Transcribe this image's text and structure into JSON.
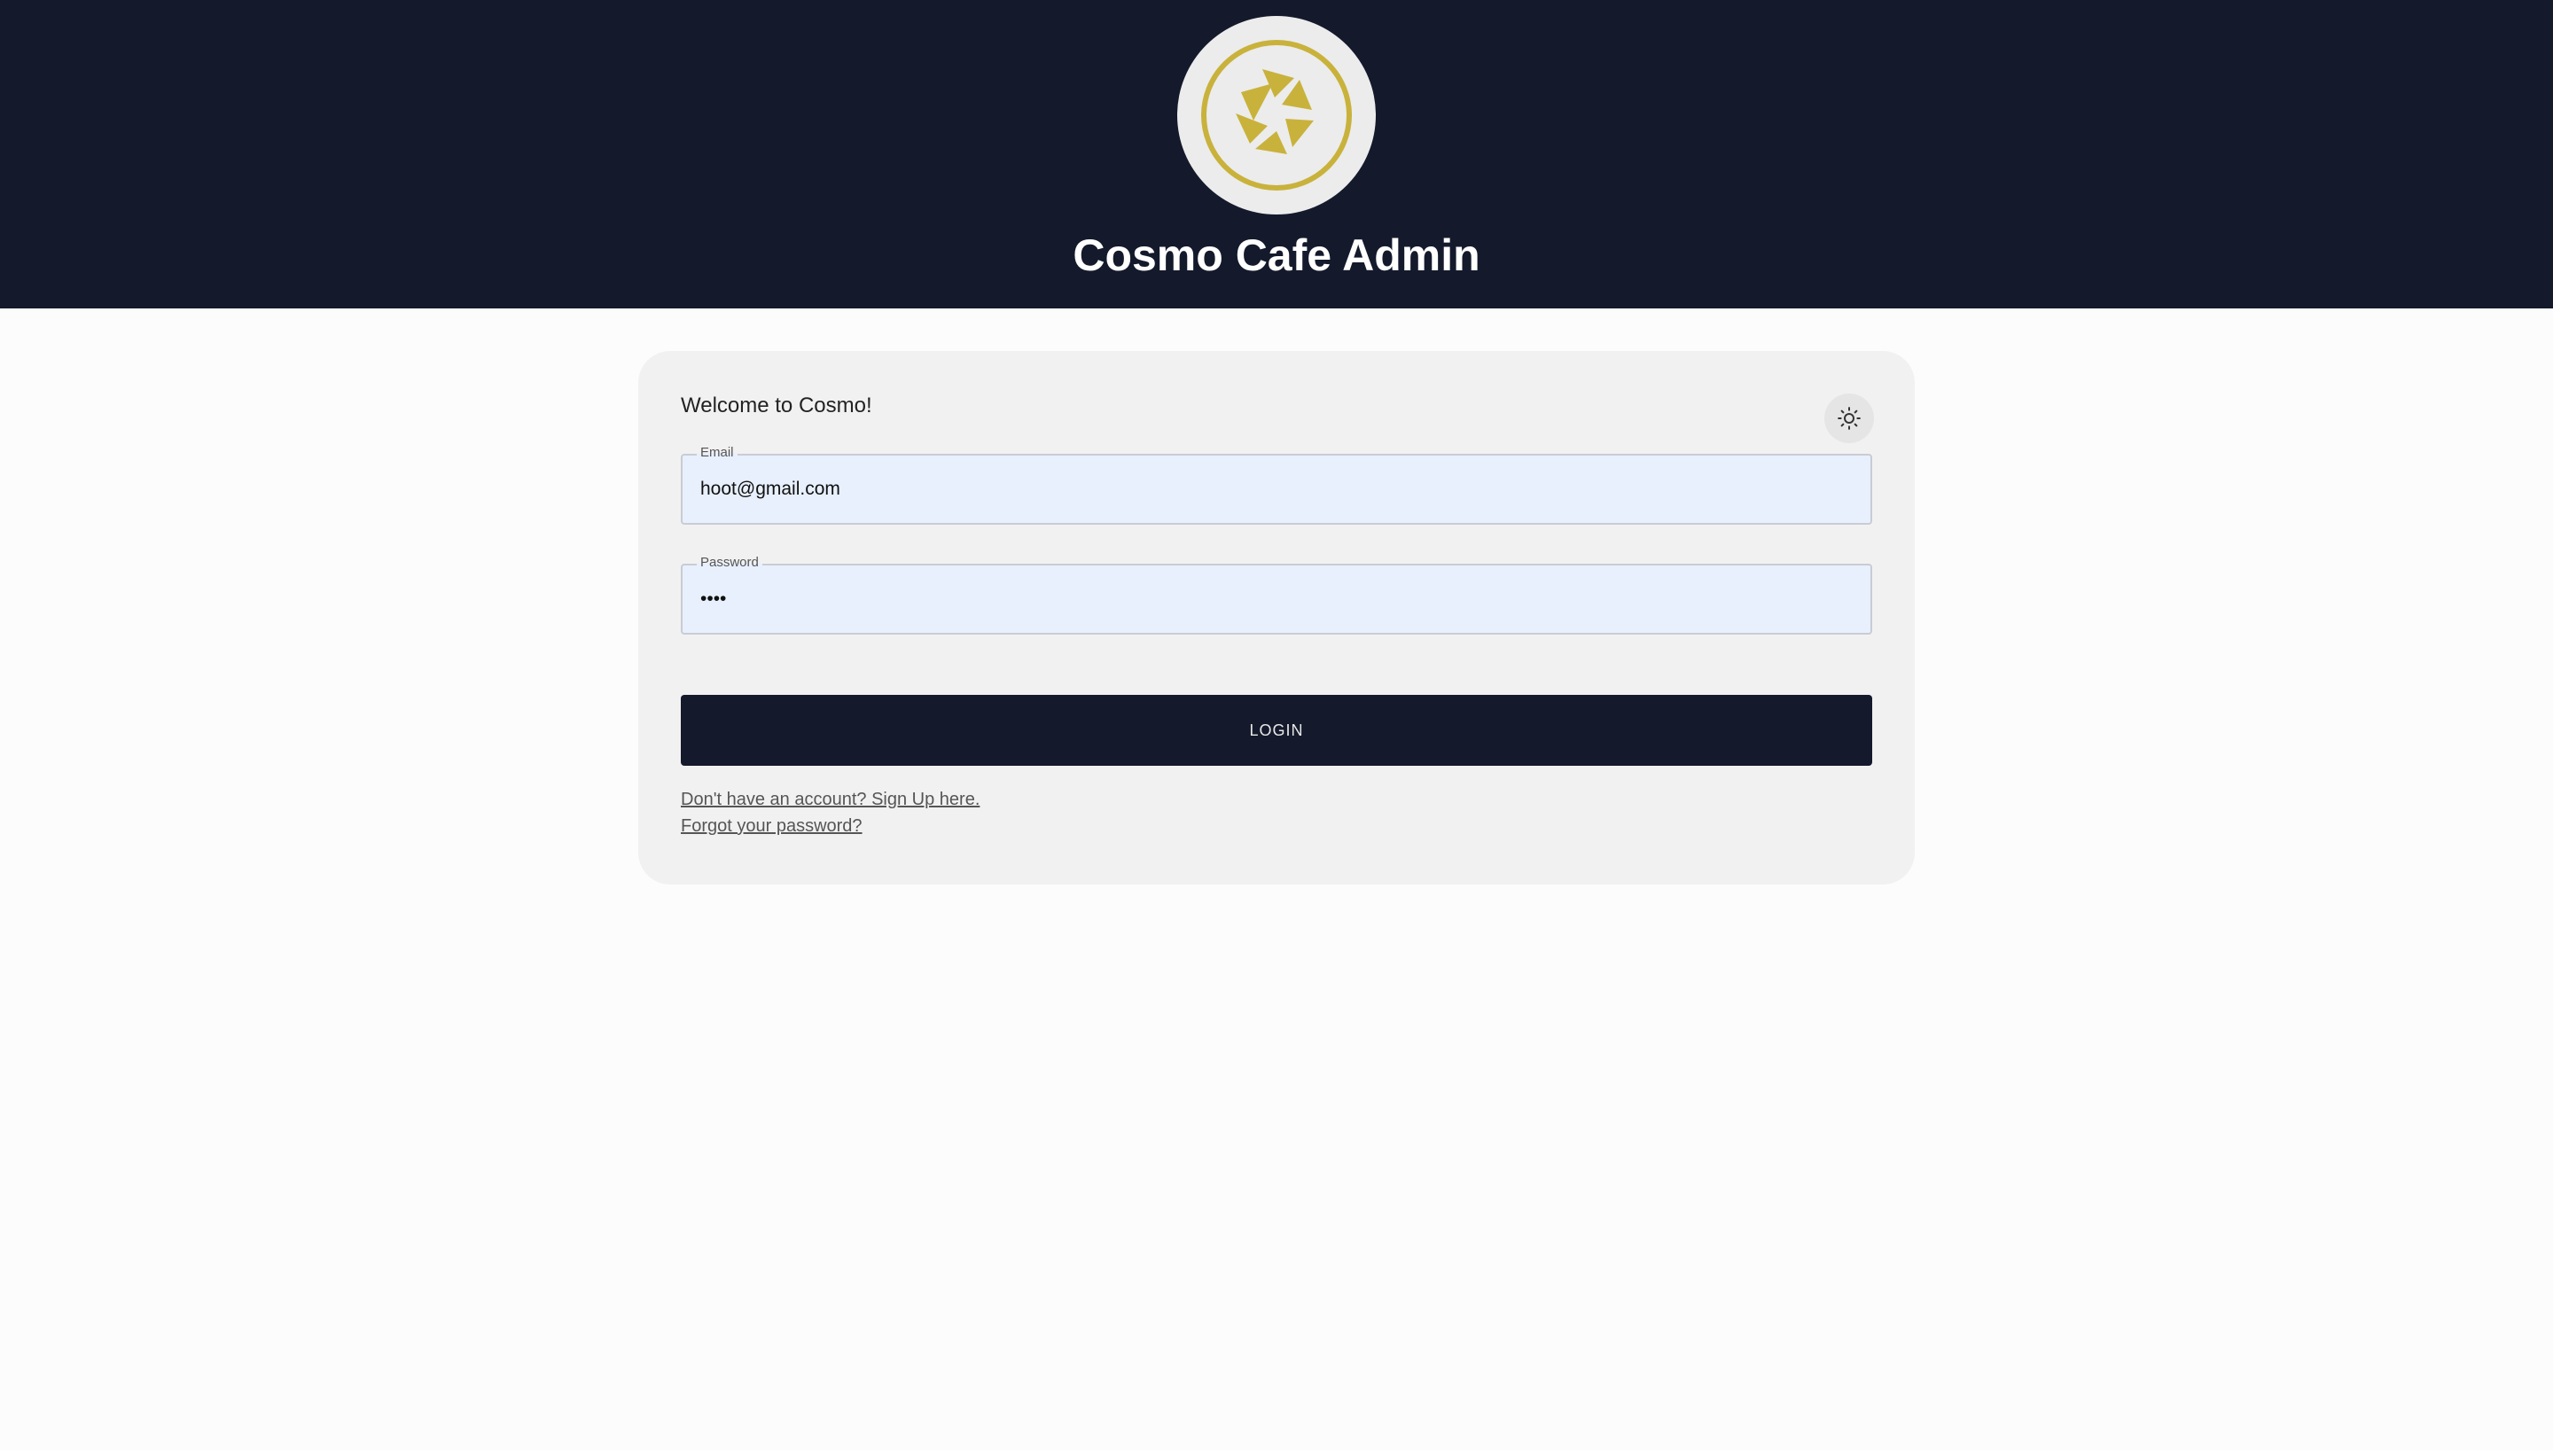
{
  "header": {
    "logo": "cosmo-logo",
    "title": "Cosmo Cafe Admin"
  },
  "login_card": {
    "welcome_text": "Welcome to Cosmo!",
    "theme_toggle_icon": "sun-icon",
    "email": {
      "label": "Email",
      "value": "hoot@gmail.com"
    },
    "password": {
      "label": "Password",
      "value": "••••"
    },
    "login_button_label": "LOGIN",
    "signup_link": "Don't have an account? Sign Up here.",
    "forgot_link": "Forgot your password?"
  },
  "colors": {
    "header_bg": "#141a2c",
    "logo_gold": "#c9b23c",
    "input_bg": "#e8f0fe",
    "card_bg": "#f2f1f1"
  }
}
